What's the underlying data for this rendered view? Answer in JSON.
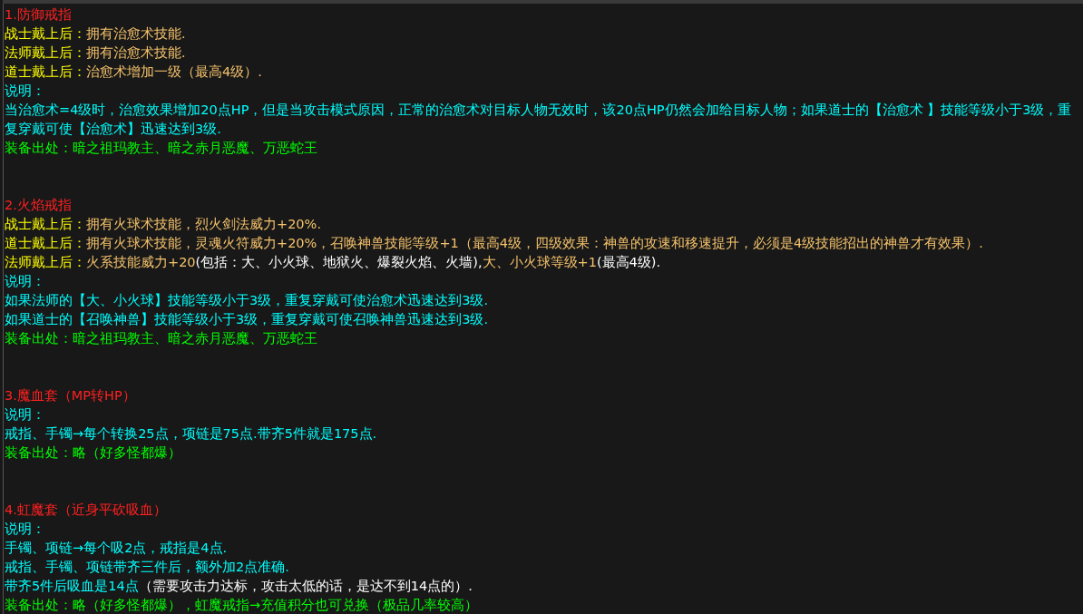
{
  "sections": [
    {
      "title": "1.防御戒指",
      "lines": [
        {
          "segments": [
            {
              "text": "战士戴上后：",
              "color": "#ffff00"
            },
            {
              "text": "拥有治愈术技能.",
              "color": "#f5c26b"
            }
          ]
        },
        {
          "segments": [
            {
              "text": "法师戴上后：",
              "color": "#ffff00"
            },
            {
              "text": "拥有治愈术技能.",
              "color": "#f5c26b"
            }
          ]
        },
        {
          "segments": [
            {
              "text": "道士戴上后：",
              "color": "#ffff00"
            },
            {
              "text": "治愈术增加一级（最高4级）.",
              "color": "#f5c26b"
            }
          ]
        },
        {
          "segments": [
            {
              "text": "说明：",
              "color": "#00ffff"
            }
          ]
        },
        {
          "segments": [
            {
              "text": "当治愈术=4级时，治愈效果增加20点HP，但是当攻击模式原因，正常的治愈术对目标人物无效时，该20点HP仍然会加给目标人物；如果道士的【治愈术 】技能等级小于3级，重复穿戴可使【治愈术】迅速达到3级.",
              "color": "#00ffff"
            }
          ]
        },
        {
          "segments": [
            {
              "text": "装备出处：暗之祖玛教主、暗之赤月恶魔、万恶蛇王",
              "color": "#00ff00"
            }
          ]
        }
      ]
    },
    {
      "title": "2.火焰戒指",
      "lines": [
        {
          "segments": [
            {
              "text": "战士戴上后：",
              "color": "#ffff00"
            },
            {
              "text": "拥有火球术技能，烈火剑法威力+20%.",
              "color": "#f5c26b"
            }
          ]
        },
        {
          "segments": [
            {
              "text": "道士戴上后：",
              "color": "#ffff00"
            },
            {
              "text": "拥有火球术技能，灵魂火符威力+20%，召唤神兽技能等级+1（最高4级，四级效果：神兽的攻速和移速提升，必须是4级技能招出的神兽才有效果）.",
              "color": "#f5c26b"
            }
          ]
        },
        {
          "segments": [
            {
              "text": "法师戴上后：",
              "color": "#ffff00"
            },
            {
              "text": "火系技能威力+20",
              "color": "#f5c26b"
            },
            {
              "text": "(包括：大、小火球、地狱火、爆裂火焰、火墙),",
              "color": "#ffffff"
            },
            {
              "text": "大、小火球等级+1",
              "color": "#f5c26b"
            },
            {
              "text": "(最高4级).",
              "color": "#ffffff"
            }
          ]
        },
        {
          "segments": [
            {
              "text": "说明：",
              "color": "#00ffff"
            }
          ]
        },
        {
          "segments": [
            {
              "text": "如果法师的【大、小火球】技能等级小于3级，重复穿戴可使治愈术迅速达到3级.",
              "color": "#00ffff"
            }
          ]
        },
        {
          "segments": [
            {
              "text": "如果道士的【召唤神兽】技能等级小于3级，重复穿戴可使召唤神兽迅速达到3级.",
              "color": "#00ffff"
            }
          ]
        },
        {
          "segments": [
            {
              "text": "装备出处：暗之祖玛教主、暗之赤月恶魔、万恶蛇王",
              "color": "#00ff00"
            }
          ]
        }
      ]
    },
    {
      "title": "3.魔血套（MP转HP）",
      "lines": [
        {
          "segments": [
            {
              "text": "说明：",
              "color": "#00ffff"
            }
          ]
        },
        {
          "segments": [
            {
              "text": "戒指、手镯→每个转换25点，项链是75点.带齐5件就是175点.",
              "color": "#00ffff"
            }
          ]
        },
        {
          "segments": [
            {
              "text": "装备出处：略（好多怪都爆）",
              "color": "#00ff00"
            }
          ]
        }
      ]
    },
    {
      "title": "4.虹魔套（近身平砍吸血）",
      "lines": [
        {
          "segments": [
            {
              "text": "说明：",
              "color": "#00ffff"
            }
          ]
        },
        {
          "segments": [
            {
              "text": "手镯、项链→每个吸2点，戒指是4点.",
              "color": "#00ffff"
            }
          ]
        },
        {
          "segments": [
            {
              "text": "戒指、手镯、项链带齐三件后，额外加2点准确.",
              "color": "#00ffff"
            }
          ]
        },
        {
          "segments": [
            {
              "text": "带齐5件后吸血是14点",
              "color": "#00ffff"
            },
            {
              "text": "（需要攻击力达标，攻击太低的话，是达不到14点的）.",
              "color": "#ffffff"
            }
          ]
        },
        {
          "segments": [
            {
              "text": "装备出处：略（好多怪都爆），虹魔戒指→充值积分也可兑换（极品几率较高）",
              "color": "#00ff00"
            }
          ]
        }
      ]
    }
  ]
}
